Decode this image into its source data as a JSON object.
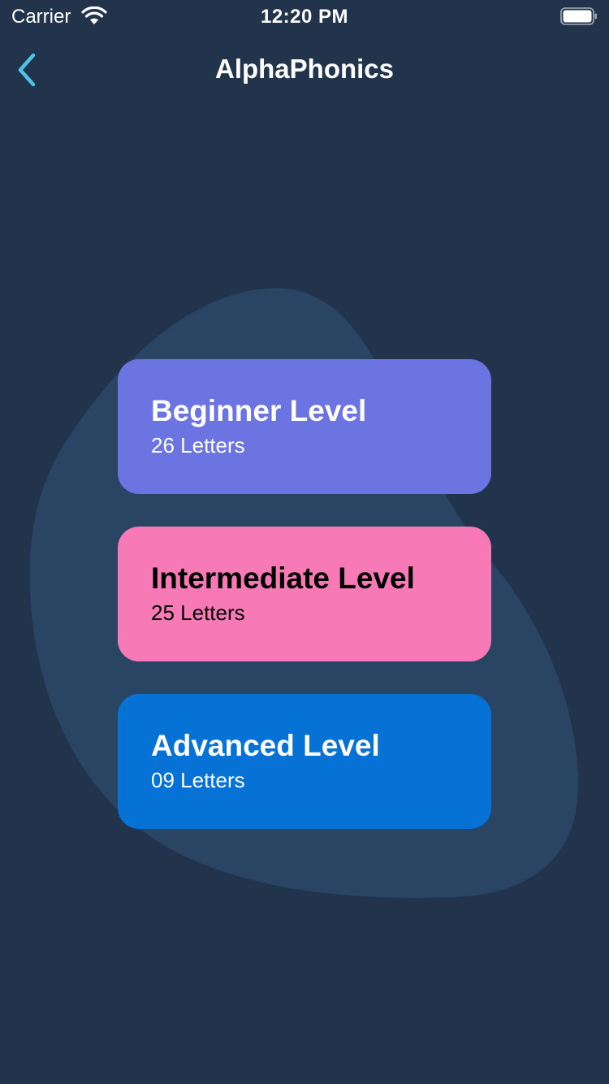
{
  "status_bar": {
    "carrier": "Carrier",
    "time": "12:20 PM",
    "icons": [
      "wifi-icon",
      "battery-icon"
    ]
  },
  "nav": {
    "title": "AlphaPhonics",
    "back_icon": "chevron-left-icon",
    "accent_color": "#4fc3e8"
  },
  "theme": {
    "background": "#21344c",
    "blob": "#294563"
  },
  "levels": [
    {
      "title": "Beginner Level",
      "subtitle": "26 Letters",
      "color": "#6b74e0",
      "text_color": "#ffffff"
    },
    {
      "title": "Intermediate Level",
      "subtitle": "25 Letters",
      "color": "#f77ab7",
      "text_color": "#000000"
    },
    {
      "title": "Advanced Level",
      "subtitle": "09 Letters",
      "color": "#0672d6",
      "text_color": "#ffffff"
    }
  ]
}
